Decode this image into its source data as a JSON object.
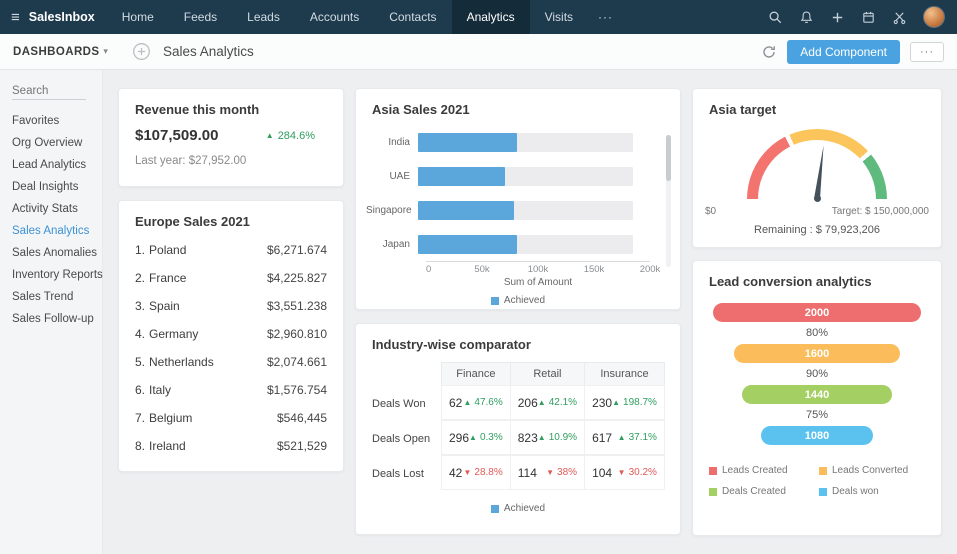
{
  "colors": {
    "up": "#2f9e5f",
    "down": "#df5a57",
    "accent": "#4aa3e0"
  },
  "topnav": {
    "brand": "SalesInbox",
    "items": [
      "Home",
      "Feeds",
      "Leads",
      "Accounts",
      "Contacts",
      "Analytics",
      "Visits"
    ],
    "active": "Analytics",
    "more_label": "···"
  },
  "toolbar": {
    "dashboards_label": "DASHBOARDS",
    "page_title": "Sales Analytics",
    "add_component_label": "Add Component",
    "more_label": "···",
    "accent_color": "#4aa3e0"
  },
  "sidebar": {
    "search_placeholder": "Search",
    "items": [
      "Favorites",
      "Org Overview",
      "Lead Analytics",
      "Deal Insights",
      "Activity Stats",
      "Sales Analytics",
      "Sales Anomalies",
      "Inventory Reports",
      "Sales Trend",
      "Sales Follow-up"
    ],
    "active_item": "Sales Analytics",
    "active_color": "#3d91d6"
  },
  "kpi_revenue": {
    "title": "Revenue this month",
    "value": "$107,509.00",
    "change": "284.6%",
    "change_dir": "up",
    "last_year_label": "Last year:  $27,952.00"
  },
  "europe_sales": {
    "title": "Europe Sales 2021",
    "items": [
      {
        "rank": "1.",
        "country": "Poland",
        "amount": "$6,271.674"
      },
      {
        "rank": "2.",
        "country": "France",
        "amount": "$4,225.827"
      },
      {
        "rank": "3.",
        "country": "Spain",
        "amount": "$3,551.238"
      },
      {
        "rank": "4.",
        "country": "Germany",
        "amount": "$2,960.810"
      },
      {
        "rank": "5.",
        "country": "Netherlands",
        "amount": "$2,074.661"
      },
      {
        "rank": "6.",
        "country": "Italy",
        "amount": "$1,576.754"
      },
      {
        "rank": "7.",
        "country": "Belgium",
        "amount": "$546,445"
      },
      {
        "rank": "8.",
        "country": "Ireland",
        "amount": "$521,529"
      }
    ]
  },
  "chart_data": [
    {
      "id": "asia_sales",
      "type": "bar",
      "orientation": "horizontal",
      "title": "Asia Sales 2021",
      "categories": [
        "India",
        "UAE",
        "Singapore",
        "Japan"
      ],
      "series": [
        {
          "name": "Achieved",
          "values": [
            85000,
            75000,
            83000,
            85000
          ]
        }
      ],
      "target_track": 185000,
      "xlim": [
        0,
        200000
      ],
      "xticks": [
        "0",
        "50k",
        "100k",
        "150k",
        "200k"
      ],
      "xlabel": "Sum of Amount",
      "legend": [
        {
          "label": "Achieved",
          "color": "#5ba7dc"
        }
      ]
    },
    {
      "id": "industry_comparator",
      "type": "table",
      "title": "Industry-wise comparator",
      "columns": [
        "Finance",
        "Retail",
        "Insurance"
      ],
      "rows": [
        {
          "label": "Deals Won",
          "cells": [
            {
              "value": "62",
              "change": "47.6%",
              "dir": "up"
            },
            {
              "value": "206",
              "change": "42.1%",
              "dir": "up"
            },
            {
              "value": "230",
              "change": "198.7%",
              "dir": "up"
            }
          ]
        },
        {
          "label": "Deals Open",
          "cells": [
            {
              "value": "296",
              "change": "0.3%",
              "dir": "up"
            },
            {
              "value": "823",
              "change": "10.9%",
              "dir": "up"
            },
            {
              "value": "617",
              "change": "37.1%",
              "dir": "up"
            }
          ]
        },
        {
          "label": "Deals Lost",
          "cells": [
            {
              "value": "42",
              "change": "28.8%",
              "dir": "down"
            },
            {
              "value": "114",
              "change": "38%",
              "dir": "down"
            },
            {
              "value": "104",
              "change": "30.2%",
              "dir": "down"
            }
          ]
        }
      ],
      "legend": [
        {
          "label": "Achieved",
          "color": "#5ba7dc"
        }
      ]
    },
    {
      "id": "asia_target",
      "type": "gauge",
      "title": "Asia target",
      "min_label": "$0",
      "target_label": "Target: $ 150,000,000",
      "remaining_label": "Remaining : $ 79,923,206",
      "needle_angle_deg": 7,
      "segments": [
        {
          "color": "#f3736f",
          "to_pct": 36
        },
        {
          "color": "#fbc55c",
          "to_pct": 77
        },
        {
          "color": "#5fba7d",
          "to_pct": 100
        }
      ]
    },
    {
      "id": "lead_conversion",
      "type": "funnel",
      "title": "Lead conversion analytics",
      "stages": [
        {
          "label": "Leads Created",
          "value": 2000,
          "color": "#ee6e70"
        },
        {
          "label": "Leads Converted",
          "value": 1600,
          "color": "#fbbd5b"
        },
        {
          "label": "Deals Created",
          "value": 1440,
          "color": "#a4cf62"
        },
        {
          "label": "Deals won",
          "value": 1080,
          "color": "#5bc2ef"
        }
      ],
      "conversions": [
        "80%",
        "90%",
        "75%"
      ]
    }
  ]
}
